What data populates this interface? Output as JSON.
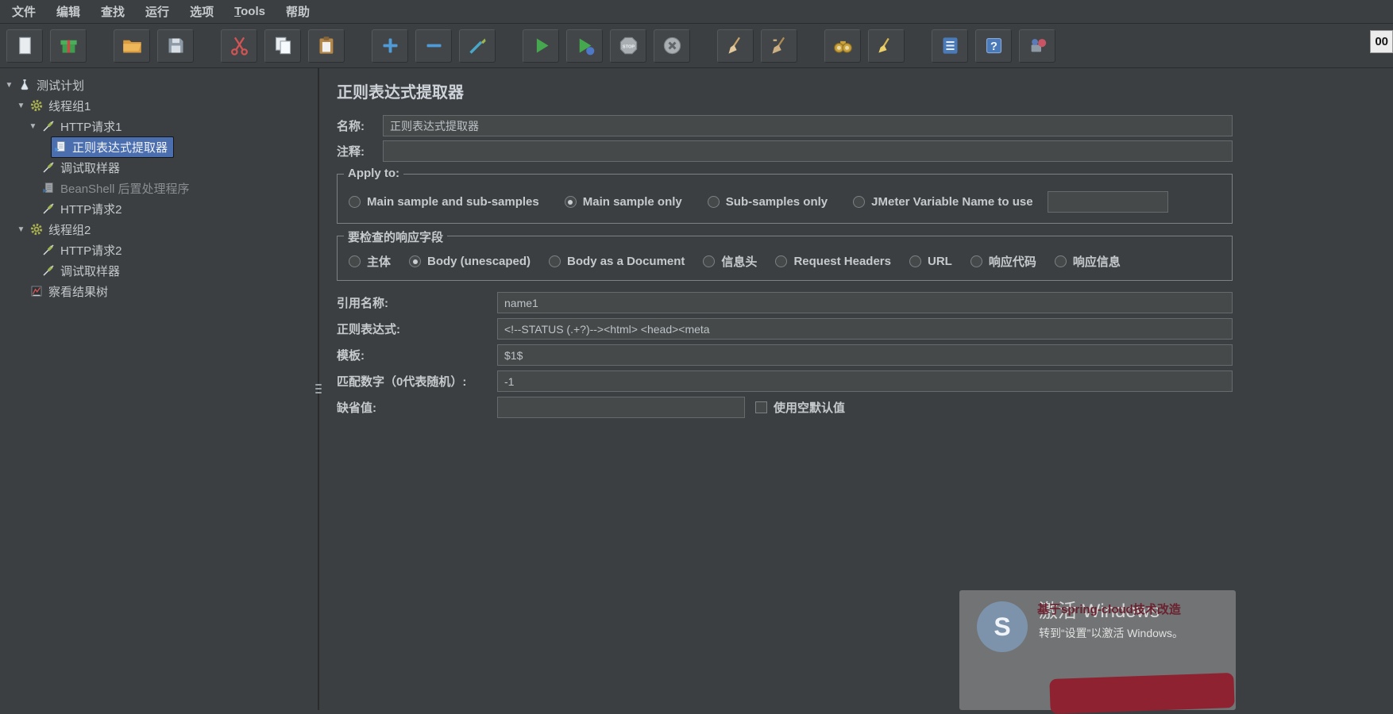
{
  "menu": {
    "items": [
      {
        "name": "file",
        "label": "文件"
      },
      {
        "name": "edit",
        "label": "编辑"
      },
      {
        "name": "search",
        "label": "查找"
      },
      {
        "name": "run",
        "label": "运行"
      },
      {
        "name": "options",
        "label": "选项"
      },
      {
        "name": "tools",
        "label": "Tools",
        "mnemonic": "T"
      },
      {
        "name": "help",
        "label": "帮助"
      }
    ]
  },
  "toolbar": {
    "timer": "00",
    "groups": [
      [
        "new-file",
        "templates"
      ],
      [
        "open-file",
        "save"
      ],
      [
        "cut",
        "copy",
        "paste"
      ],
      [
        "expand-all",
        "collapse-all",
        "toggle"
      ],
      [
        "start",
        "start-no-pauses",
        "stop",
        "shutdown"
      ],
      [
        "clear",
        "clear-all"
      ],
      [
        "search",
        "search-reset"
      ],
      [
        "function-helper",
        "help",
        "options-tool"
      ]
    ]
  },
  "tree": {
    "items": [
      {
        "name": "test-plan",
        "label": "测试计划",
        "level": 0,
        "expanded": true,
        "icon": "test-plan",
        "selected": false,
        "disabled": false
      },
      {
        "name": "thread-group-1",
        "label": "线程组1",
        "level": 1,
        "expanded": true,
        "icon": "thread-group",
        "selected": false,
        "disabled": false
      },
      {
        "name": "http-request-1",
        "label": "HTTP请求1",
        "level": 2,
        "expanded": true,
        "icon": "sampler",
        "selected": false,
        "disabled": false
      },
      {
        "name": "regex-extractor",
        "label": "正则表达式提取器",
        "level": 3,
        "expanded": false,
        "icon": "post-processor",
        "selected": true,
        "disabled": false
      },
      {
        "name": "debug-sampler-1",
        "label": "调试取样器",
        "level": 2,
        "expanded": false,
        "icon": "sampler",
        "selected": false,
        "disabled": false
      },
      {
        "name": "beanshell-postprocessor",
        "label": "BeanShell 后置处理程序",
        "level": 2,
        "expanded": false,
        "icon": "post-processor",
        "selected": false,
        "disabled": true
      },
      {
        "name": "http-request-2",
        "label": "HTTP请求2",
        "level": 2,
        "expanded": false,
        "icon": "sampler",
        "selected": false,
        "disabled": false
      },
      {
        "name": "thread-group-2",
        "label": "线程组2",
        "level": 1,
        "expanded": true,
        "icon": "thread-group",
        "selected": false,
        "disabled": false
      },
      {
        "name": "http-request-2b",
        "label": "HTTP请求2",
        "level": 2,
        "expanded": false,
        "icon": "sampler",
        "selected": false,
        "disabled": false
      },
      {
        "name": "debug-sampler-2",
        "label": "调试取样器",
        "level": 2,
        "expanded": false,
        "icon": "sampler",
        "selected": false,
        "disabled": false
      },
      {
        "name": "view-results-tree",
        "label": "察看结果树",
        "level": 1,
        "expanded": false,
        "icon": "results-tree",
        "selected": false,
        "disabled": false
      }
    ]
  },
  "main": {
    "title": "正则表达式提取器",
    "name_label": "名称:",
    "name_value": "正则表达式提取器",
    "comment_label": "注释:",
    "comment_value": "",
    "apply_to": {
      "title": "Apply to:",
      "options": [
        {
          "label": "Main sample and sub-samples",
          "selected": false
        },
        {
          "label": "Main sample only",
          "selected": true
        },
        {
          "label": "Sub-samples only",
          "selected": false
        },
        {
          "label": "JMeter Variable Name to use",
          "selected": false,
          "input_value": ""
        }
      ]
    },
    "response_field": {
      "title": "要检查的响应字段",
      "options": [
        {
          "label": "主体",
          "selected": false
        },
        {
          "label": "Body (unescaped)",
          "selected": true
        },
        {
          "label": "Body as a Document",
          "selected": false
        },
        {
          "label": "信息头",
          "selected": false
        },
        {
          "label": "Request Headers",
          "selected": false
        },
        {
          "label": "URL",
          "selected": false
        },
        {
          "label": "响应代码",
          "selected": false
        },
        {
          "label": "响应信息",
          "selected": false
        }
      ]
    },
    "fields": [
      {
        "name": "reference-name",
        "label": "引用名称:",
        "value": "name1"
      },
      {
        "name": "regex",
        "label": "正则表达式:",
        "value": "<!--STATUS (.+?)--><html> <head><meta"
      },
      {
        "name": "template",
        "label": "模板:",
        "value": "$1$"
      },
      {
        "name": "match-number",
        "label": "匹配数字（0代表随机）:",
        "value": "-1"
      },
      {
        "name": "default-value",
        "label": "缺省值:",
        "value": "",
        "checkbox_label": "使用空默认值",
        "checkbox_checked": false
      }
    ]
  },
  "overlay": {
    "avatar_text": "S",
    "red_title": "基于spring-cloud技术改造",
    "activate_title": "激活 Windows",
    "activate_subtitle": "转到“设置”以激活 Windows。"
  }
}
